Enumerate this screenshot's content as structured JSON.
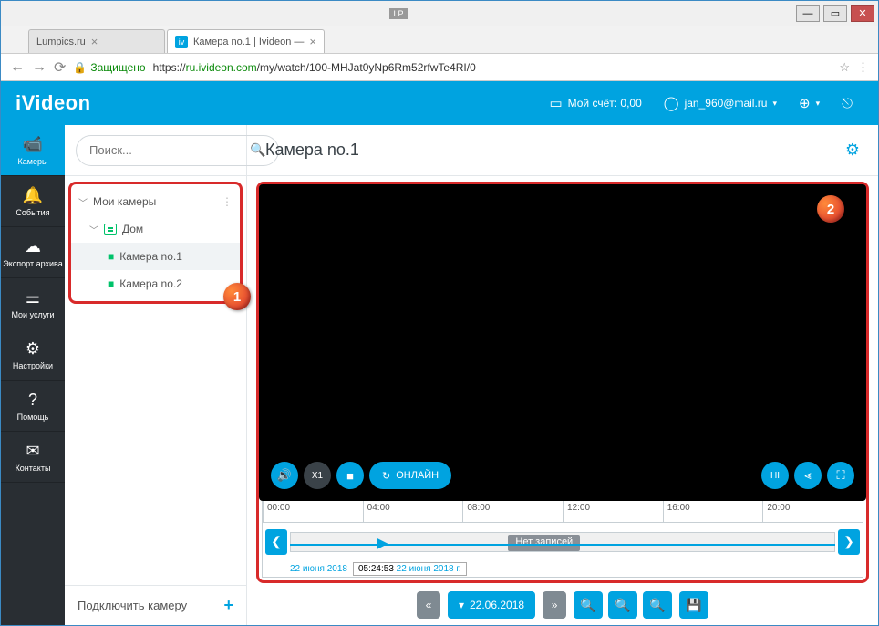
{
  "window": {
    "lp_badge": "LP"
  },
  "browser": {
    "tabs": [
      {
        "label": "Lumpics.ru",
        "active": false
      },
      {
        "label": "Камера no.1 | Ivideon — ",
        "active": true
      }
    ],
    "secure_label": "Защищено",
    "url_prefix": "https://",
    "url_host": "ru.ivideon.com",
    "url_path": "/my/watch/100-MHJat0yNp6Rm52rfwTe4RI/0"
  },
  "header": {
    "logo": "iVideon",
    "balance_label": "Мой счёт: 0,00",
    "user_email": "jan_960@mail.ru"
  },
  "rail": {
    "items": [
      {
        "label": "Камеры"
      },
      {
        "label": "События"
      },
      {
        "label": "Экспорт архива"
      },
      {
        "label": "Мои услуги"
      },
      {
        "label": "Настройки"
      },
      {
        "label": "Помощь"
      },
      {
        "label": "Контакты"
      }
    ]
  },
  "sidebar": {
    "search_placeholder": "Поиск...",
    "root_label": "Мои камеры",
    "group_label": "Дом",
    "cameras": [
      {
        "label": "Камера no.1"
      },
      {
        "label": "Камера no.2"
      }
    ],
    "connect_label": "Подключить камеру"
  },
  "main": {
    "title": "Камера no.1"
  },
  "player": {
    "speed": "X1",
    "online_label": "ОНЛАЙН",
    "hi_label": "HI"
  },
  "timeline": {
    "ticks": [
      "00:00",
      "04:00",
      "08:00",
      "12:00",
      "16:00",
      "20:00"
    ],
    "norec_label": "Нет записей",
    "date_short": "22 июня 2018",
    "tooltip_time": "05:24:53",
    "tooltip_date": "22 июня 2018 г.",
    "picker_date": "22.06.2018"
  },
  "annotations": {
    "b1": "1",
    "b2": "2"
  }
}
